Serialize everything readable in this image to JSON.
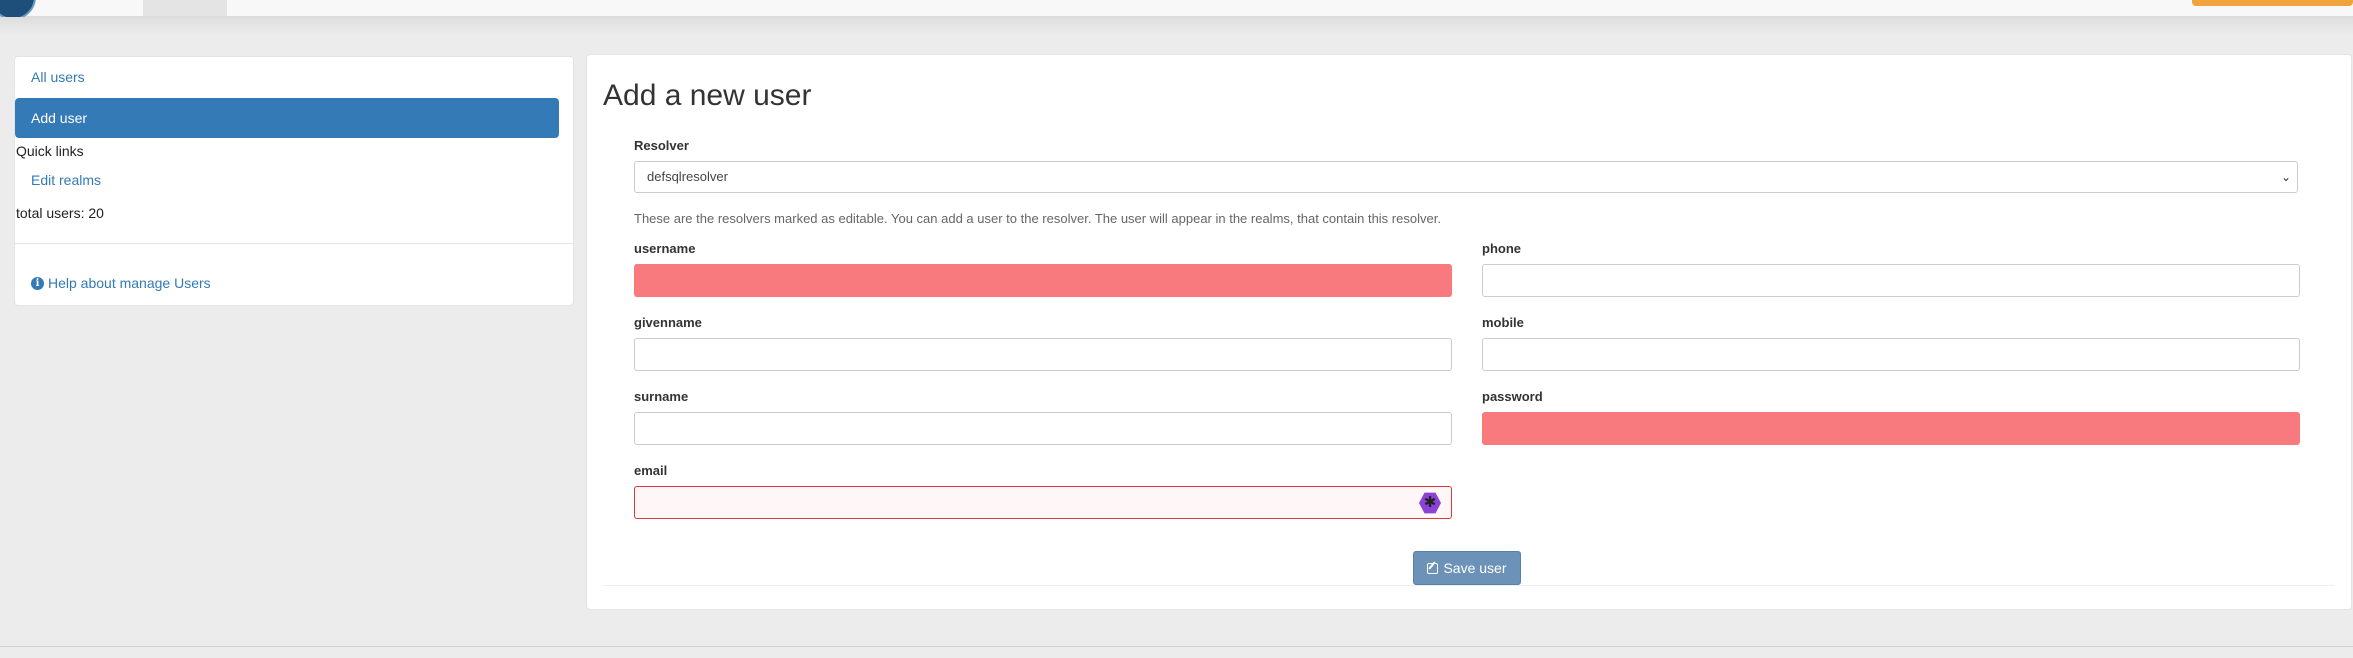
{
  "sidebar": {
    "all_users": "All users",
    "add_user": "Add user",
    "quick_links": "Quick links",
    "edit_realms": "Edit realms",
    "total_users": "total users: 20",
    "help": "Help about manage Users"
  },
  "main": {
    "title": "Add a new user",
    "resolver_label": "Resolver",
    "resolver_value": "defsqlresolver",
    "resolver_help": "These are the resolvers marked as editable. You can add a user to the resolver. The user will appear in the realms, that contain this resolver.",
    "fields": {
      "username": "username",
      "phone": "phone",
      "givenname": "givenname",
      "mobile": "mobile",
      "surname": "surname",
      "password": "password",
      "email": "email"
    },
    "save_label": "Save user"
  },
  "colors": {
    "primary": "#337ab7",
    "invalid_fill": "#f87a7f",
    "save_button": "#6c92b8",
    "top_button": "#f0a33a"
  }
}
